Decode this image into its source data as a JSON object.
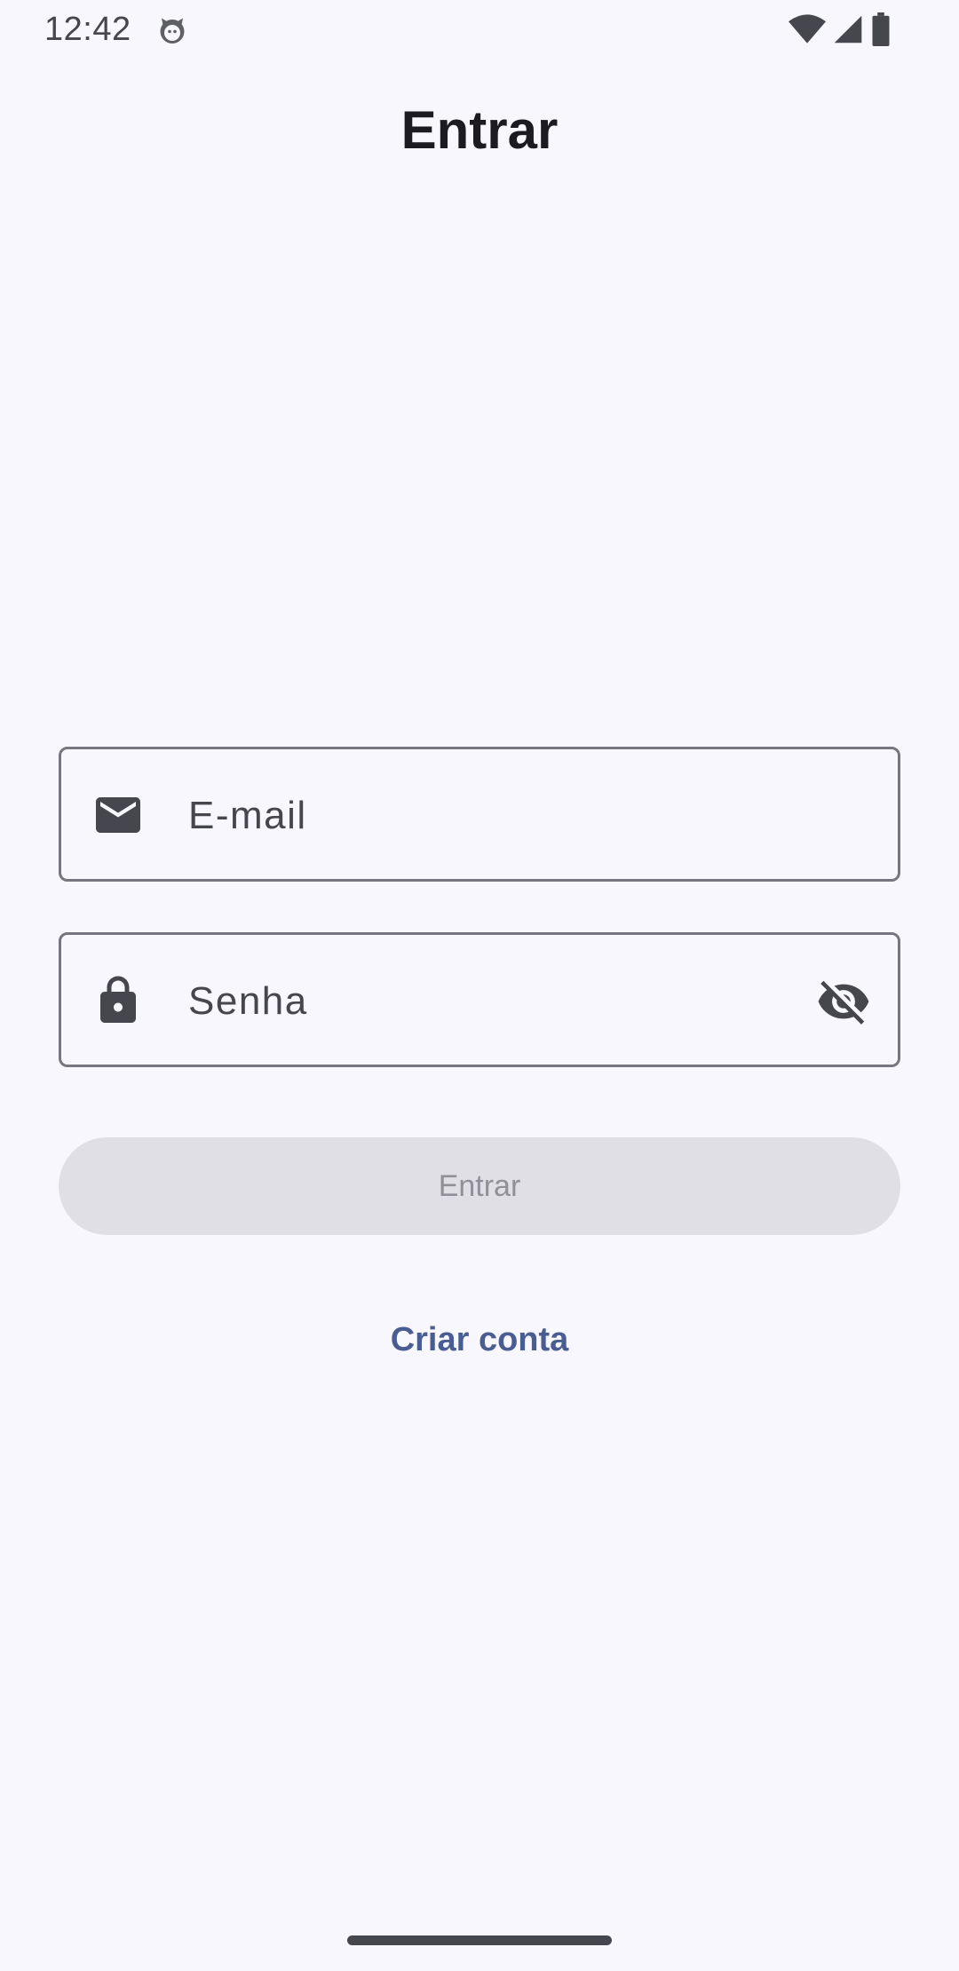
{
  "status_bar": {
    "time": "12:42",
    "icons": [
      "app-notification-icon",
      "wifi-icon",
      "cellular-signal-icon",
      "battery-icon"
    ]
  },
  "header": {
    "title": "Entrar"
  },
  "form": {
    "email": {
      "placeholder": "E-mail",
      "value": "",
      "icon": "email-icon"
    },
    "password": {
      "placeholder": "Senha",
      "value": "",
      "icon": "lock-icon",
      "visibility_icon": "visibility-off-icon"
    },
    "submit_label": "Entrar",
    "submit_enabled": false,
    "create_account_label": "Criar conta"
  },
  "colors": {
    "background": "#f8f7fd",
    "field_border": "#767680",
    "icon": "#46464f",
    "button_disabled_bg": "#e0dfe5",
    "button_disabled_text": "#919097",
    "link": "#4a5d92"
  }
}
